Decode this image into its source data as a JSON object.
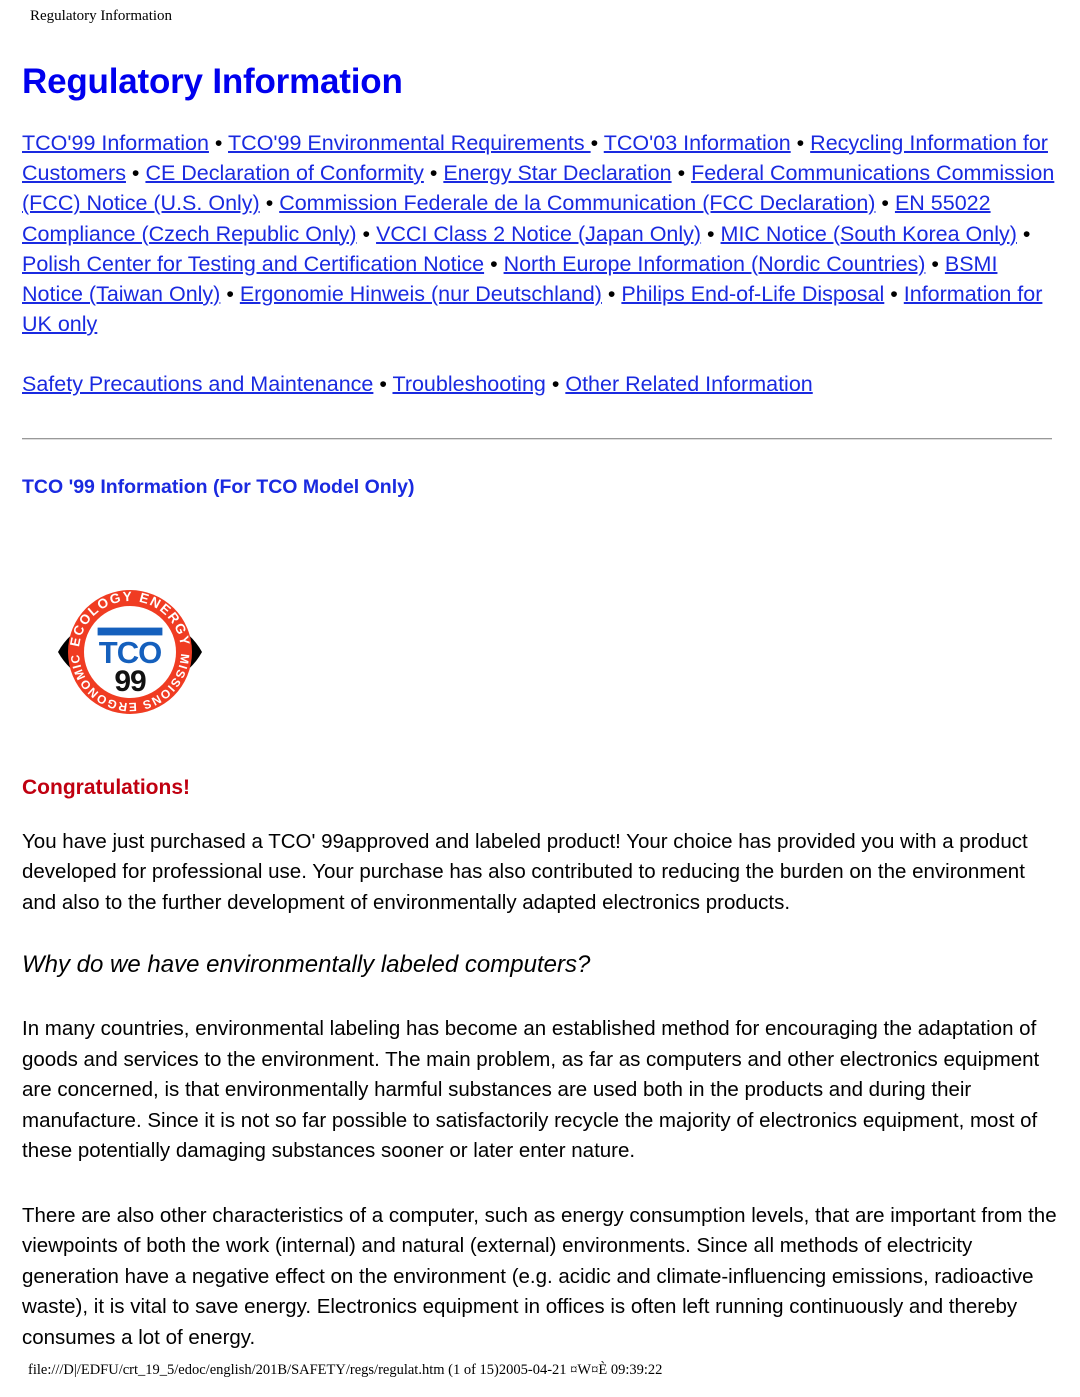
{
  "header": {
    "running_title": "Regulatory Information"
  },
  "page": {
    "title": "Regulatory Information"
  },
  "nav": {
    "primary_links": [
      "TCO'99 Information",
      "TCO'99 Environmental Requirements ",
      "TCO'03 Information",
      "Recycling Information for Customers",
      " CE Declaration of Conformity",
      "Energy Star Declaration",
      "Federal Communications Commission (FCC) Notice (U.S. Only)",
      "Commission Federale de la Communication (FCC Declaration)",
      "EN 55022 Compliance (Czech Republic Only)",
      "VCCI Class 2 Notice (Japan Only)",
      "MIC Notice (South Korea Only)",
      "Polish Center for Testing and Certification Notice",
      "North Europe Information (Nordic Countries)",
      "BSMI Notice (Taiwan Only)",
      "Ergonomie Hinweis (nur Deutschland)",
      "Philips End-of-Life Disposal",
      "Information for UK only"
    ],
    "secondary_links": [
      "Safety Precautions and Maintenance",
      "Troubleshooting",
      "Other Related Information"
    ],
    "separator": "•"
  },
  "section": {
    "heading": "TCO '99 Information (For TCO Model Only)",
    "congratulations": "Congratulations!",
    "paragraph_1": "You have just purchased a TCO' 99approved and labeled product! Your choice has provided you with a product developed for professional use. Your purchase has also contributed to reducing the burden on the environment and also to the further development of environmentally adapted electronics products.",
    "subheading_italic": "Why do we have environmentally labeled computers?",
    "paragraph_2": "In many countries, environmental labeling has become an established method for encouraging the adaptation of goods and services to the environment. The main problem, as far as computers and other electronics equipment are concerned, is that environmentally harmful substances are used both in the products and during their manufacture. Since it is not so far possible to satisfactorily recycle the majority of electronics equipment, most of these potentially damaging substances sooner or later enter nature.",
    "paragraph_3": "There are also other characteristics of a computer, such as energy consumption levels, that are important from the viewpoints of both the work (internal) and natural (external) environments. Since all methods of electricity generation have a negative effect on the environment (e.g. acidic and climate-influencing emissions, radioactive waste), it is vital to save energy. Electronics equipment in offices is often left running continuously and thereby consumes a lot of energy."
  },
  "logo": {
    "name": "TCO 99",
    "brand_text": "TCO",
    "year_text": "99",
    "ring_top_text": "ECOLOGY ENERGY",
    "ring_bottom_text": "EMISSIONS ERGONOMICS",
    "ring_color": "#f03c22",
    "brand_color": "#1560bd",
    "lens_color": "#000000"
  },
  "footer": {
    "path_line": "file:///D|/EDFU/crt_19_5/edoc/english/201B/SAFETY/regs/regulat.htm (1 of 15)2005-04-21 ¤W¤È 09:39:22"
  },
  "colors": {
    "link": "#1a2ae0",
    "title": "#0000ee",
    "accent_red": "#c00010",
    "text": "#000000"
  }
}
